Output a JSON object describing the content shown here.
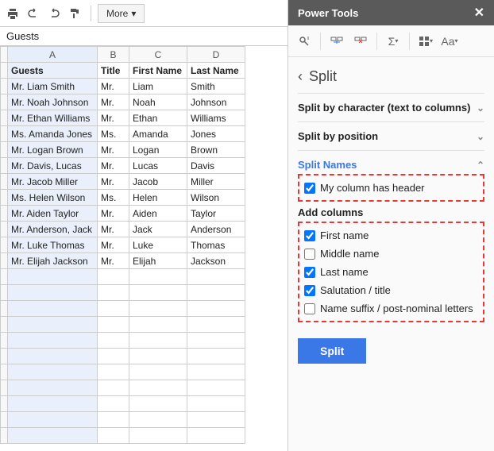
{
  "toolbar": {
    "more_label": "More"
  },
  "namebox": "Guests",
  "columns": [
    "A",
    "B",
    "C",
    "D"
  ],
  "headers": [
    "Guests",
    "Title",
    "First Name",
    "Last Name"
  ],
  "rows": [
    [
      "Mr. Liam Smith",
      "Mr.",
      "Liam",
      "Smith"
    ],
    [
      "Mr. Noah Johnson",
      "Mr.",
      "Noah",
      "Johnson"
    ],
    [
      "Mr. Ethan Williams",
      "Mr.",
      "Ethan",
      "Williams"
    ],
    [
      "Ms. Amanda Jones",
      "Ms.",
      "Amanda",
      "Jones"
    ],
    [
      "Mr. Logan Brown",
      "Mr.",
      "Logan",
      "Brown"
    ],
    [
      "Mr. Davis, Lucas",
      "Mr.",
      "Lucas",
      "Davis"
    ],
    [
      "Mr. Jacob Miller",
      "Mr.",
      "Jacob",
      "Miller"
    ],
    [
      "Ms. Helen Wilson",
      "Ms.",
      "Helen",
      "Wilson"
    ],
    [
      "Mr. Aiden Taylor",
      "Mr.",
      "Aiden",
      "Taylor"
    ],
    [
      "Mr. Anderson, Jack",
      "Mr.",
      "Jack",
      "Anderson"
    ],
    [
      "Mr. Luke Thomas",
      "Mr.",
      "Luke",
      "Thomas"
    ],
    [
      "Mr. Elijah Jackson",
      "Mr.",
      "Elijah",
      "Jackson"
    ]
  ],
  "panel": {
    "title": "Power Tools",
    "back_label": "Split",
    "sec_char": "Split by character (text to columns)",
    "sec_pos": "Split by position",
    "sec_names": "Split Names",
    "opt_header": "My column has header",
    "addcols_label": "Add columns",
    "opts": {
      "first": "First name",
      "middle": "Middle name",
      "last": "Last name",
      "salutation": "Salutation / title",
      "suffix": "Name suffix / post-nominal letters"
    },
    "split_btn": "Split"
  }
}
